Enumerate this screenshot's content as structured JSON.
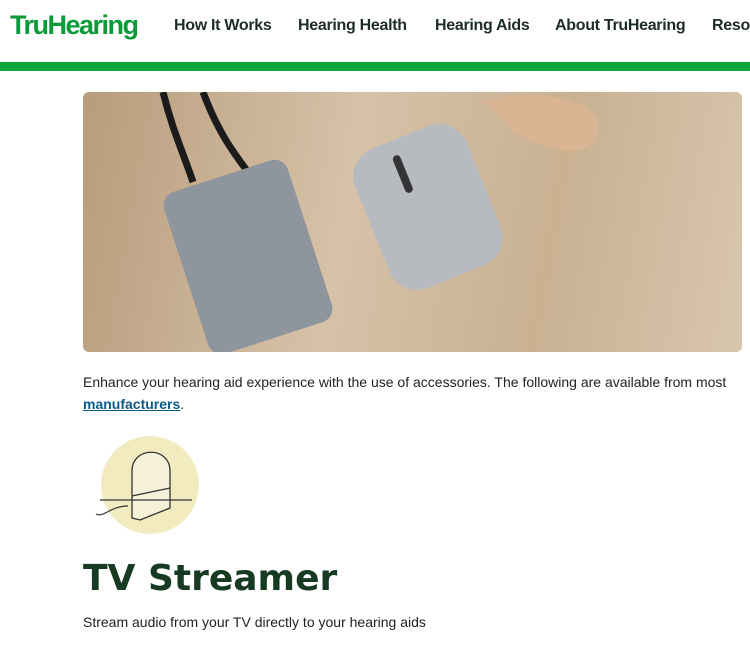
{
  "header": {
    "logo": "TruHearing",
    "nav": [
      "How It Works",
      "Hearing Health",
      "Hearing Aids",
      "About TruHearing",
      "Resou"
    ]
  },
  "colors": {
    "brand": "#0aa53a",
    "heading": "#173a22",
    "link": "#0c5a8a"
  },
  "intro": {
    "text": "Enhance your hearing aid experience with the use of accessories. The following are available from most ",
    "link": "manufacturers",
    "end": "."
  },
  "section": {
    "icon": "tv-streamer-icon",
    "title": "TV Streamer",
    "description": "Stream audio from your TV directly to your hearing aids"
  }
}
